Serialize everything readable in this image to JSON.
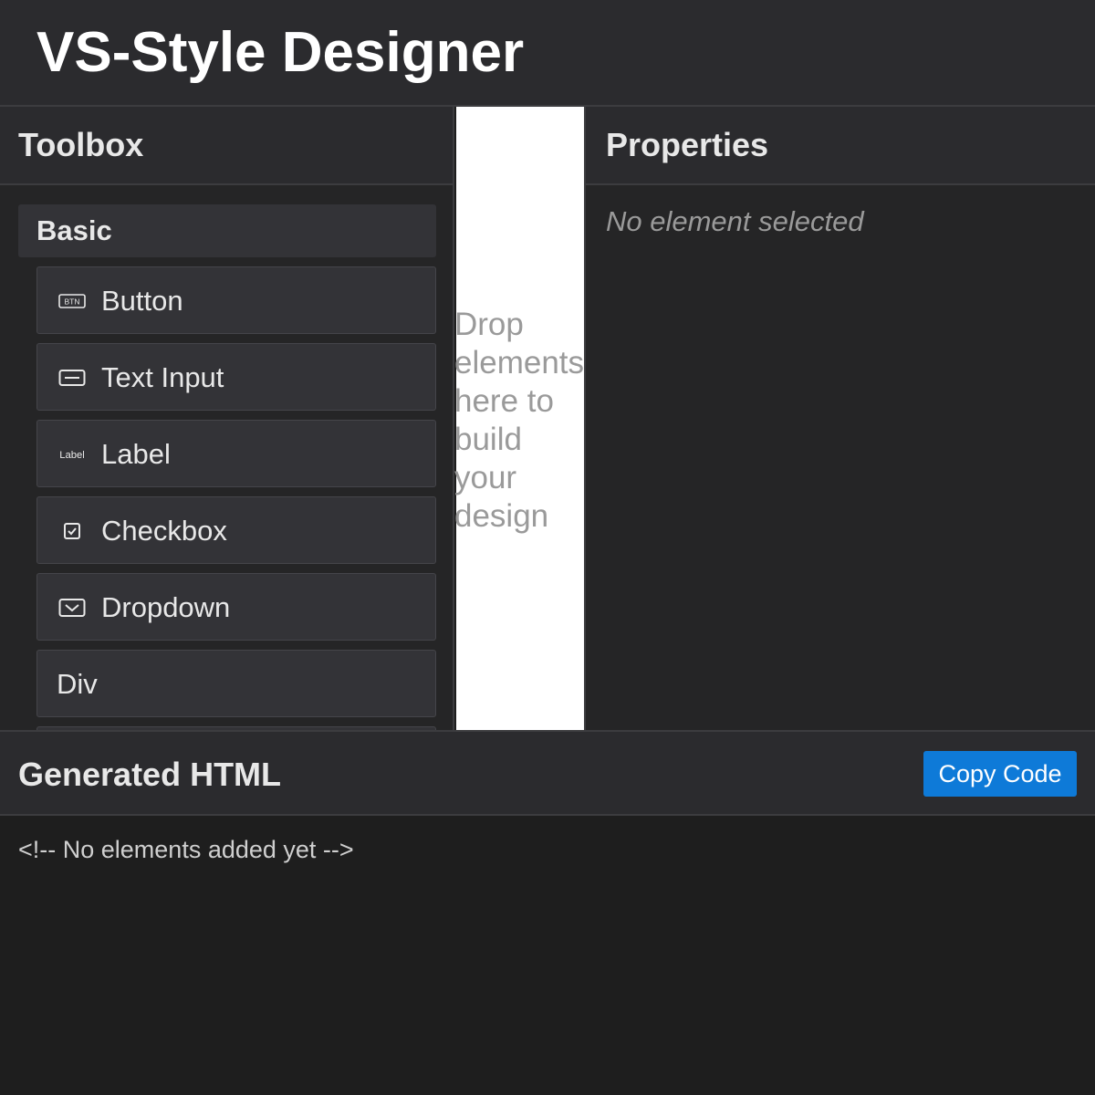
{
  "app": {
    "title": "VS-Style Designer"
  },
  "toolbox": {
    "title": "Toolbox",
    "category": "Basic",
    "items": [
      {
        "label": "Button",
        "icon": "button-icon",
        "icon_text": "BTN"
      },
      {
        "label": "Text Input",
        "icon": "text-input-icon"
      },
      {
        "label": "Label",
        "icon": "label-icon",
        "icon_text": "Label"
      },
      {
        "label": "Checkbox",
        "icon": "checkbox-icon"
      },
      {
        "label": "Dropdown",
        "icon": "dropdown-icon"
      },
      {
        "label": "Div"
      }
    ]
  },
  "canvas": {
    "hint": "Drop elements here to build your design"
  },
  "properties": {
    "title": "Properties",
    "empty_text": "No element selected"
  },
  "code": {
    "title": "Generated HTML",
    "copy_label": "Copy Code",
    "output": "<!-- No elements added yet -->"
  },
  "colors": {
    "accent": "#0e7ad8",
    "background": "#1e1e1e",
    "panel": "#252526",
    "header": "#2b2b2e",
    "item": "#333337"
  }
}
